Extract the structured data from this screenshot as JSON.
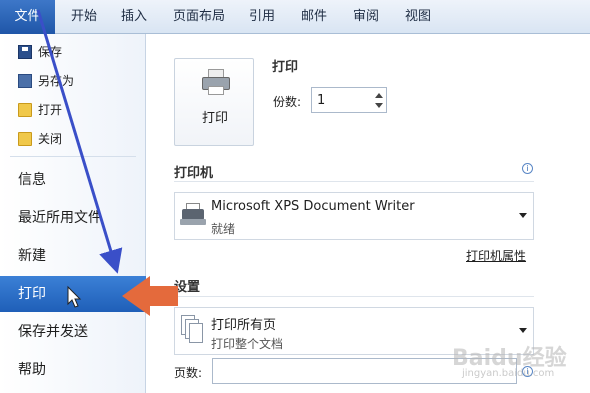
{
  "ribbon": {
    "tabs": [
      {
        "label": "文件"
      },
      {
        "label": "开始"
      },
      {
        "label": "插入"
      },
      {
        "label": "页面布局"
      },
      {
        "label": "引用"
      },
      {
        "label": "邮件"
      },
      {
        "label": "审阅"
      },
      {
        "label": "视图"
      }
    ]
  },
  "backstage": {
    "small_items": [
      {
        "label": "保存",
        "icon": "save-icon"
      },
      {
        "label": "另存为",
        "icon": "save-as-icon"
      },
      {
        "label": "打开",
        "icon": "open-folder-icon"
      },
      {
        "label": "关闭",
        "icon": "close-folder-icon"
      }
    ],
    "big_items": [
      {
        "label": "信息"
      },
      {
        "label": "最近所用文件"
      },
      {
        "label": "新建"
      },
      {
        "label": "打印"
      },
      {
        "label": "保存并发送"
      },
      {
        "label": "帮助"
      }
    ]
  },
  "print": {
    "button_label": "打印",
    "heading": "打印",
    "copies_label": "份数:",
    "copies_value": "1"
  },
  "printer": {
    "heading": "打印机",
    "name": "Microsoft XPS Document Writer",
    "status": "就绪",
    "properties_link": "打印机属性"
  },
  "settings": {
    "heading": "设置",
    "range_main": "打印所有页",
    "range_sub": "打印整个文档",
    "pages_label": "页数:"
  },
  "watermark": {
    "text": "Baidu经验",
    "sub": "jingyan.baidu.com"
  },
  "colors": {
    "accent_blue": "#2f6fc4",
    "arrow_blue": "#3a4fc8",
    "arrow_orange": "#e46a3c"
  }
}
